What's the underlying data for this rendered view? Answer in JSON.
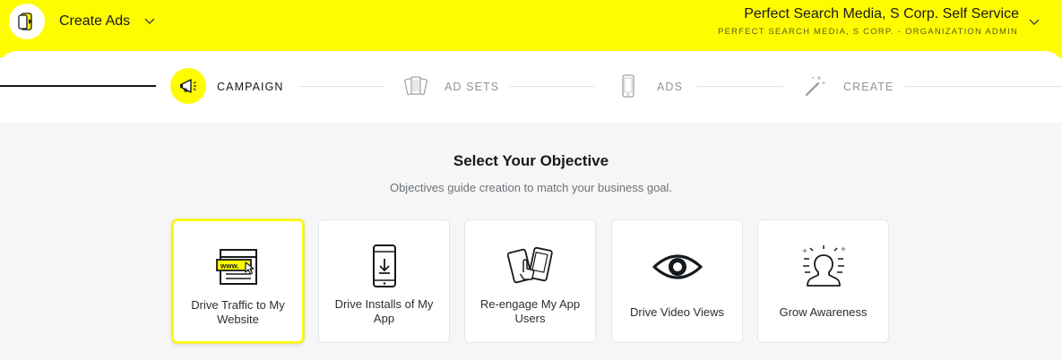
{
  "header": {
    "app_title": "Create Ads",
    "org_name": "Perfect Search Media, S Corp. Self Service",
    "org_role": "PERFECT SEARCH MEDIA, S CORP. - ORGANIZATION ADMIN",
    "accent_color": "#fffc00"
  },
  "stepper": {
    "steps": [
      {
        "label": "CAMPAIGN",
        "icon": "megaphone-icon",
        "state": "current"
      },
      {
        "label": "AD SETS",
        "icon": "ad-sets-icon",
        "state": "upcoming"
      },
      {
        "label": "ADS",
        "icon": "phone-icon",
        "state": "upcoming"
      },
      {
        "label": "CREATE",
        "icon": "magic-wand-icon",
        "state": "upcoming"
      }
    ]
  },
  "main": {
    "title": "Select Your Objective",
    "subtitle": "Objectives guide creation to match your business goal.",
    "objectives": [
      {
        "label": "Drive Traffic to My Website",
        "icon": "website-icon",
        "selected": true
      },
      {
        "label": "Drive Installs of My App",
        "icon": "app-install-icon",
        "selected": false
      },
      {
        "label": "Re-engage My App Users",
        "icon": "re-engage-icon",
        "selected": false
      },
      {
        "label": "Drive Video Views",
        "icon": "eye-icon",
        "selected": false
      },
      {
        "label": "Grow Awareness",
        "icon": "awareness-icon",
        "selected": false
      }
    ],
    "website_icon_text": "www."
  }
}
